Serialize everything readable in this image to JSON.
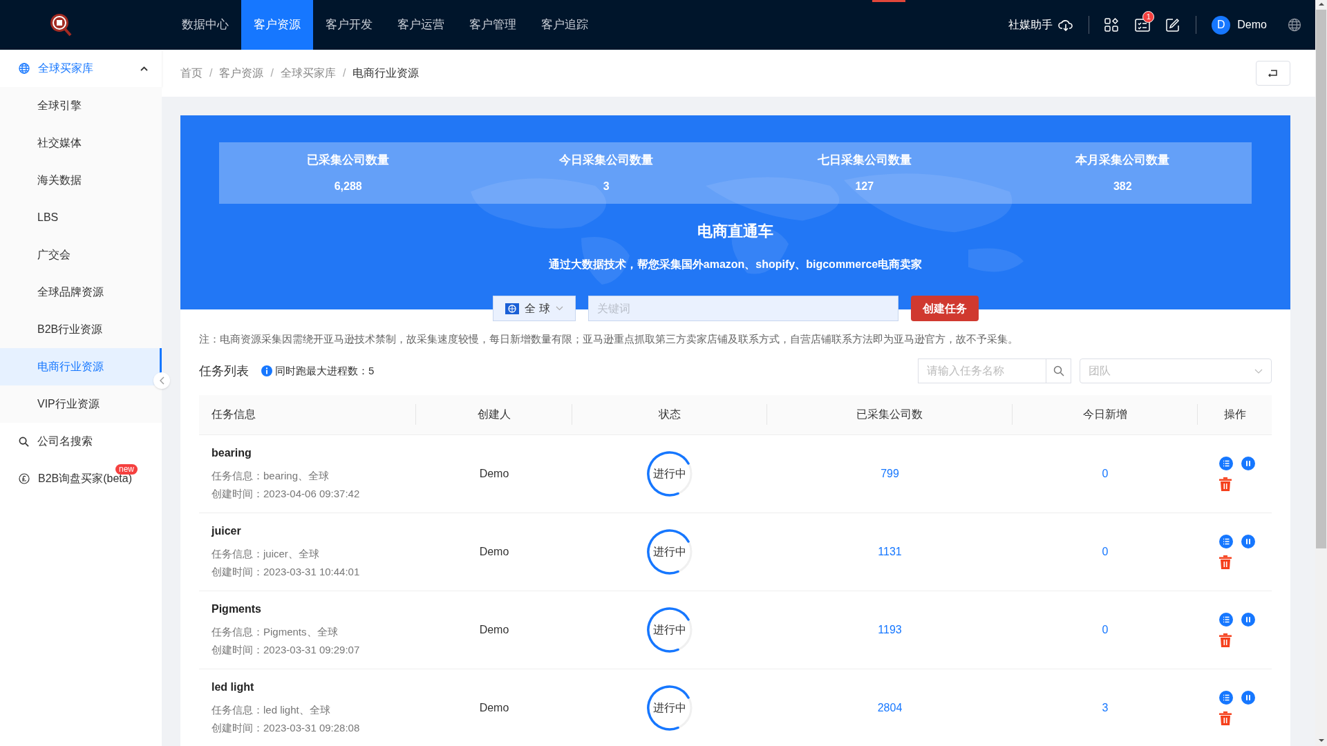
{
  "top_nav": [
    {
      "label": "数据中心",
      "selected": false
    },
    {
      "label": "客户资源",
      "selected": true
    },
    {
      "label": "客户开发",
      "selected": false
    },
    {
      "label": "客户运营",
      "selected": false
    },
    {
      "label": "客户管理",
      "selected": false
    },
    {
      "label": "客户追踪",
      "selected": false
    }
  ],
  "header": {
    "assistant": "社媒助手",
    "notification_count": "1",
    "user_initial": "D",
    "user_name": "Demo"
  },
  "sidebar": {
    "items": [
      {
        "label": "全球买家库",
        "kind": "group",
        "expanded": true,
        "children": [
          {
            "label": "全球引擎",
            "selected": false
          },
          {
            "label": "社交媒体",
            "selected": false
          },
          {
            "label": "海关数据",
            "selected": false
          },
          {
            "label": "LBS",
            "selected": false
          },
          {
            "label": "广交会",
            "selected": false
          },
          {
            "label": "全球品牌资源",
            "selected": false
          },
          {
            "label": "B2B行业资源",
            "selected": false
          },
          {
            "label": "电商行业资源",
            "selected": true
          },
          {
            "label": "VIP行业资源",
            "selected": false
          }
        ]
      },
      {
        "label": "公司名搜索",
        "kind": "search"
      },
      {
        "label": "B2B询盘买家(beta)",
        "kind": "inquiry",
        "badge": "new"
      }
    ]
  },
  "breadcrumb": [
    {
      "label": "首页"
    },
    {
      "separator": "/",
      "label": "客户资源"
    },
    {
      "separator": "/",
      "label": "全球买家库"
    },
    {
      "separator": "/",
      "label": "电商行业资源"
    }
  ],
  "banner": {
    "stats": [
      {
        "label": "已采集公司数量",
        "value": "6,288"
      },
      {
        "label": "今日采集公司数量",
        "value": "3"
      },
      {
        "label": "七日采集公司数量",
        "value": "127"
      },
      {
        "label": "本月采集公司数量",
        "value": "382"
      }
    ],
    "title": "电商直通车",
    "subtitle": "通过大数据技术，帮您采集国外amazon、shopify、bigcommerce电商卖家",
    "region": "全 球",
    "keyword_placeholder": "关键词",
    "create_button": "创建任务"
  },
  "note": "注：电商资源采集因需绕开亚马逊技术禁制，故采集速度较慢，每日新增数量有限；亚马逊重点抓取第三方卖家店铺及联系方式，自营店铺联系方法即为亚马逊官方，故不予采集。",
  "task_list": {
    "title": "任务列表",
    "max_processes": "同时跑最大进程数：5",
    "search_placeholder": "请输入任务名称",
    "team_placeholder": "团队"
  },
  "table": {
    "columns": [
      "任务信息",
      "创建人",
      "状态",
      "已采集公司数",
      "今日新增",
      "操作"
    ],
    "rows": [
      {
        "name": "bearing",
        "info": "任务信息：bearing、全球",
        "created": "创建时间：2023-04-06 09:37:42",
        "creator": "Demo",
        "status": "进行中",
        "collected": "799",
        "today": "0"
      },
      {
        "name": "juicer",
        "info": "任务信息：juicer、全球",
        "created": "创建时间：2023-03-31 10:44:01",
        "creator": "Demo",
        "status": "进行中",
        "collected": "1131",
        "today": "0"
      },
      {
        "name": "Pigments",
        "info": "任务信息：Pigments、全球",
        "created": "创建时间：2023-03-31 09:29:07",
        "creator": "Demo",
        "status": "进行中",
        "collected": "1193",
        "today": "0"
      },
      {
        "name": "led light",
        "info": "任务信息：led light、全球",
        "created": "创建时间：2023-03-31 09:28:08",
        "creator": "Demo",
        "status": "进行中",
        "collected": "2804",
        "today": "3"
      }
    ]
  }
}
